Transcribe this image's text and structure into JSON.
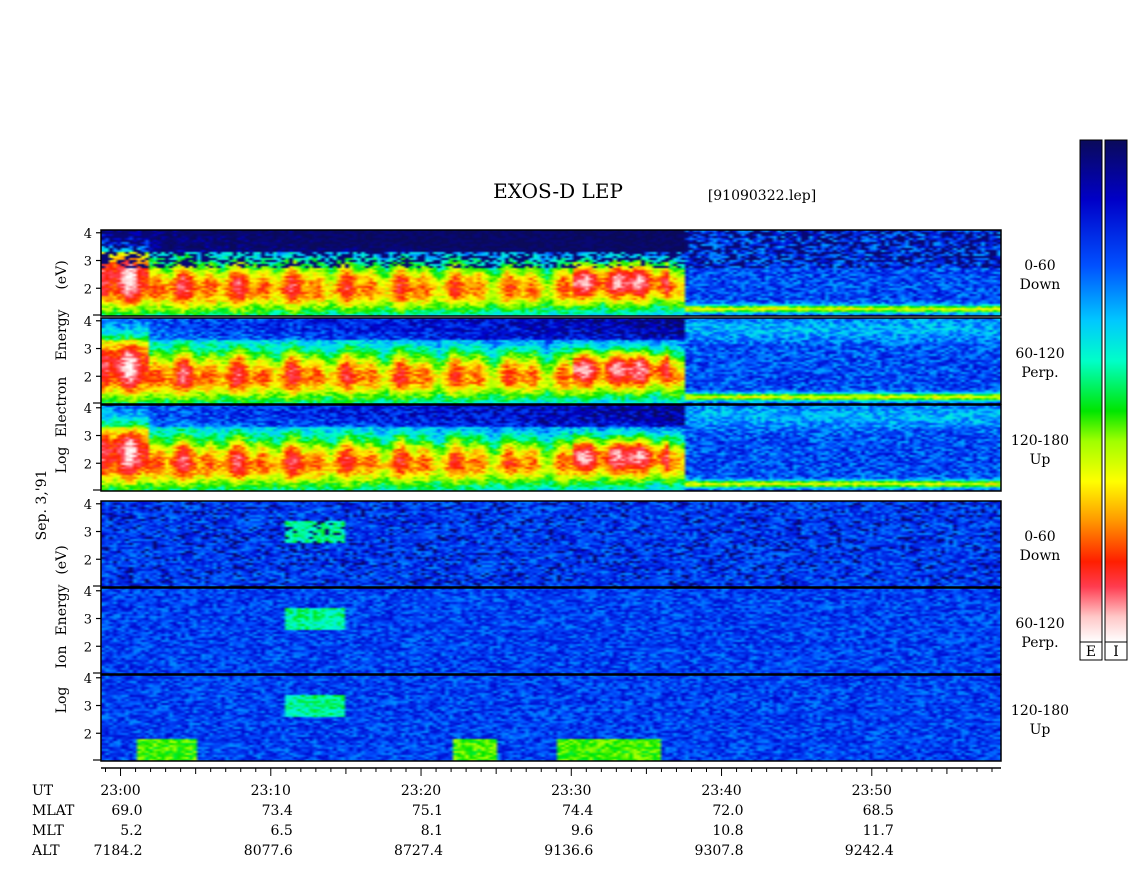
{
  "chart_data": {
    "type": "heatmap",
    "title": "EXOS-D LEP",
    "file_label": "[91090322.lep]",
    "date_label": "Sep. 3,'91",
    "x_axis": {
      "label": "UT",
      "ticks": [
        "23:00",
        "23:10",
        "23:20",
        "23:30",
        "23:40",
        "23:50"
      ],
      "tick_minutes": [
        0,
        10,
        20,
        30,
        40,
        50
      ],
      "range_minutes": [
        -1.3,
        58.6
      ]
    },
    "y_axis": {
      "ticks": [
        "4",
        "3",
        "2"
      ],
      "tick_values": [
        4,
        3,
        2
      ],
      "range": [
        1,
        4.1
      ]
    },
    "groups": [
      {
        "species": "electron",
        "ylabel": [
          "Log",
          "Electron",
          "Energy",
          "(eV)"
        ],
        "panels": [
          {
            "angle": "0-60",
            "direction": "Down"
          },
          {
            "angle": "60-120",
            "direction": "Perp."
          },
          {
            "angle": "120-180",
            "direction": "Up"
          }
        ]
      },
      {
        "species": "ion",
        "ylabel": [
          "Log",
          "Ion",
          "Energy",
          "(eV)"
        ],
        "panels": [
          {
            "angle": "0-60",
            "direction": "Down"
          },
          {
            "angle": "60-120",
            "direction": "Perp."
          },
          {
            "angle": "120-180",
            "direction": "Up"
          }
        ]
      }
    ],
    "ephemeris": [
      {
        "label": "MLAT",
        "values": [
          "69.0",
          "73.4",
          "75.1",
          "74.4",
          "72.0",
          "68.5"
        ]
      },
      {
        "label": "MLT",
        "values": [
          "5.2",
          "6.5",
          "8.1",
          "9.6",
          "10.8",
          "11.7"
        ]
      },
      {
        "label": "ALT",
        "values": [
          "7184.2",
          "8077.6",
          "8727.4",
          "9136.6",
          "9307.8",
          "9242.4"
        ]
      }
    ],
    "colorbars": [
      {
        "label": "E"
      },
      {
        "label": "I"
      }
    ],
    "colormap": [
      "#0a0a5a",
      "#0000c8",
      "#0050ff",
      "#00c8ff",
      "#00ffc8",
      "#00e600",
      "#a0ff00",
      "#ffff00",
      "#ff9600",
      "#ff1e00",
      "#ff3c50",
      "#ffc8c8",
      "#ffffff"
    ]
  }
}
